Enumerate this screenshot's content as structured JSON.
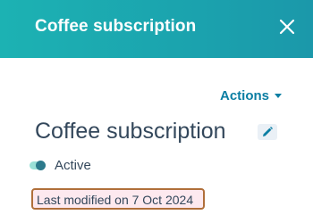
{
  "header": {
    "title": "Coffee subscription",
    "close_icon": "close-icon",
    "background": "#1cb2b3"
  },
  "actions": {
    "label": "Actions",
    "icon": "chevron-down-icon",
    "color": "#0b7ea3"
  },
  "record": {
    "title": "Coffee subscription",
    "edit_icon": "pencil-icon",
    "status": {
      "label": "Active",
      "enabled": true
    },
    "last_modified": "Last modified on 7 Oct 2024"
  }
}
